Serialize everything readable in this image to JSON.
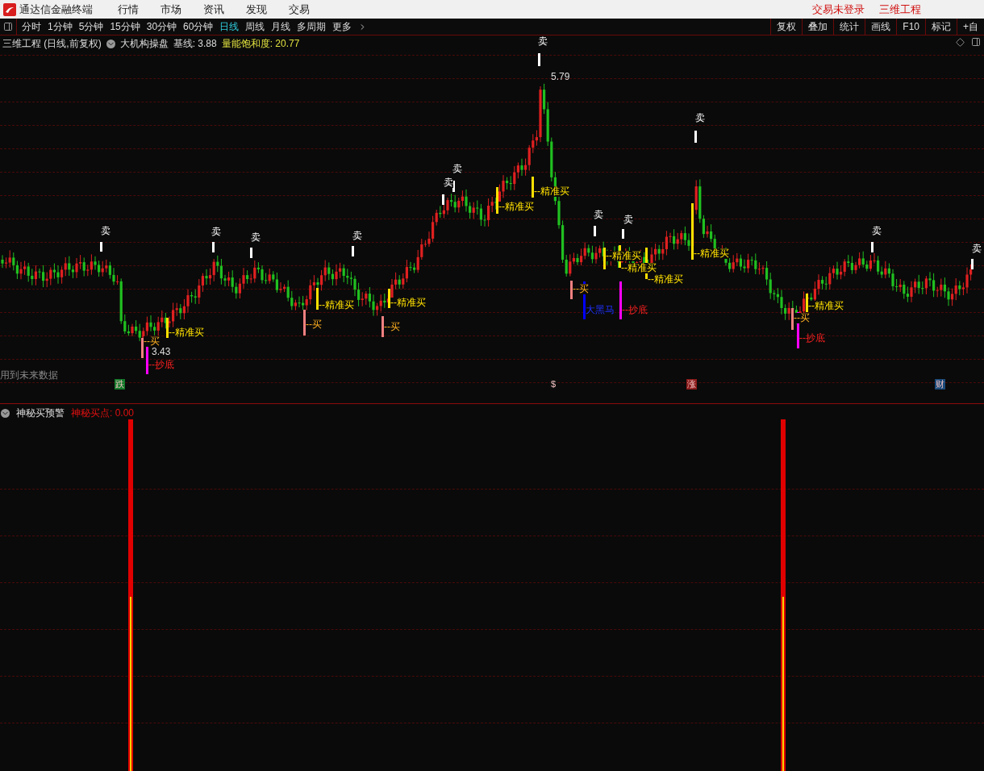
{
  "app": {
    "title": "通达信金融终端",
    "menu": [
      "行情",
      "市场",
      "资讯",
      "发现",
      "交易"
    ],
    "status": "交易未登录",
    "user": "三维工程"
  },
  "periods": [
    {
      "label": "分时",
      "selected": false
    },
    {
      "label": "1分钟",
      "selected": false
    },
    {
      "label": "5分钟",
      "selected": false
    },
    {
      "label": "15分钟",
      "selected": false
    },
    {
      "label": "30分钟",
      "selected": false
    },
    {
      "label": "60分钟",
      "selected": false
    },
    {
      "label": "日线",
      "selected": true
    },
    {
      "label": "周线",
      "selected": false
    },
    {
      "label": "月线",
      "selected": false
    },
    {
      "label": "多周期",
      "selected": false
    },
    {
      "label": "更多",
      "selected": false
    }
  ],
  "tools": [
    "复权",
    "叠加",
    "统计",
    "画线",
    "F10",
    "标记",
    "+自"
  ],
  "main_chart": {
    "title": "三维工程 (日线,前复权)",
    "indicator": "大机构操盘",
    "baseline": "基线: 3.88",
    "saturation": "量能饱和度: 20.77",
    "signals": [
      {
        "kind": "sell",
        "label": "卖"
      },
      {
        "kind": "sell",
        "label": "卖"
      },
      {
        "kind": "sell",
        "label": "卖"
      },
      {
        "kind": "sell",
        "label": "卖"
      },
      {
        "kind": "sell",
        "label": "卖"
      },
      {
        "kind": "sell",
        "label": "卖"
      },
      {
        "kind": "sell",
        "label": "卖"
      },
      {
        "kind": "sell",
        "label": "卖"
      },
      {
        "kind": "sell",
        "label": "卖"
      },
      {
        "kind": "sell",
        "label": "卖"
      },
      {
        "kind": "sell",
        "label": "卖"
      },
      {
        "kind": "sell",
        "label": "卖"
      },
      {
        "kind": "precise_buy",
        "label": "--精准买"
      },
      {
        "kind": "precise_buy",
        "label": "--精准买"
      },
      {
        "kind": "precise_buy",
        "label": "--精准买"
      },
      {
        "kind": "precise_buy",
        "label": "--精准买"
      },
      {
        "kind": "precise_buy",
        "label": "--精准买"
      },
      {
        "kind": "precise_buy",
        "label": "--精准买"
      },
      {
        "kind": "precise_buy",
        "label": "--精准买"
      },
      {
        "kind": "precise_buy",
        "label": "--精准买"
      },
      {
        "kind": "precise_buy",
        "label": "--精准买"
      },
      {
        "kind": "precise_buy",
        "label": "--精准买"
      },
      {
        "kind": "buy",
        "label": "--买"
      },
      {
        "kind": "buy",
        "label": "--买"
      },
      {
        "kind": "buy",
        "label": "--买"
      },
      {
        "kind": "buy",
        "label": "--买"
      },
      {
        "kind": "buy",
        "label": "--买"
      },
      {
        "kind": "bottom",
        "label": "--抄底"
      },
      {
        "kind": "bottom",
        "label": "--抄底"
      },
      {
        "kind": "bottom",
        "label": "--抄底"
      },
      {
        "kind": "dark_horse",
        "label": "大黑马"
      }
    ],
    "price_marks": [
      {
        "label": "5.79"
      },
      {
        "label": "3.43"
      }
    ],
    "note": "用到未来数据",
    "events": [
      {
        "label": "跌",
        "color": "#127a2a"
      },
      {
        "label": "$",
        "color": "#0c0c0c"
      },
      {
        "label": "涨",
        "color": "#8a1a1a"
      },
      {
        "label": "财",
        "color": "#1a4a7a"
      }
    ]
  },
  "sub_chart": {
    "title": "神秘买预警",
    "reading": "神秘买点: 0.00"
  }
}
